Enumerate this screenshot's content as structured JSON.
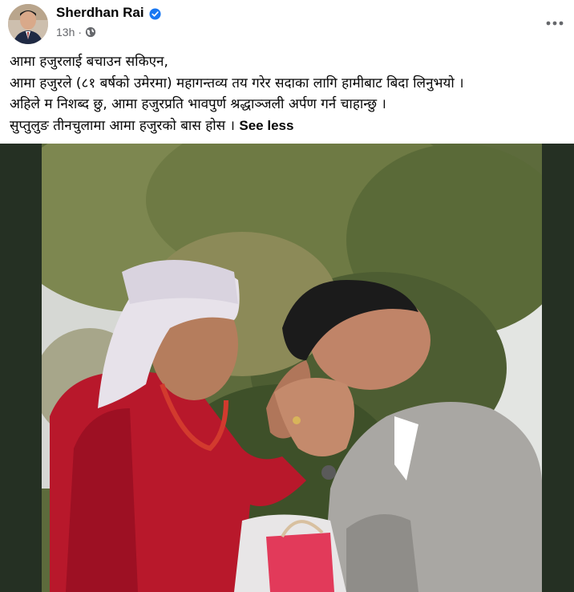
{
  "post": {
    "author": "Sherdhan Rai",
    "time": "13h",
    "separator": "·",
    "verified_icon": "verified-badge-icon",
    "audience_icon": "globe-icon",
    "more_icon": "more-horizontal-icon",
    "lines": [
      "आमा हजुरलाई बचाउन सकिएन,",
      "आमा हजुरले (८१ बर्षको उमेरमा) महागन्तव्य तय गरेर सदाका लागि हामीबाट बिदा लिनुभयो ।",
      "अहिले म निशब्द छु, आमा हजुरप्रति भावपुर्ण श्रद्धाञ्जली अर्पण गर्न चाहान्छु ।",
      "सुप्तुलुङ तीनचुलामा आमा हजुरको बास होस ।"
    ],
    "see_less": "See less"
  },
  "colors": {
    "verified": "#1877f2",
    "meta_text": "#65676b",
    "photo_border": "#253023"
  }
}
